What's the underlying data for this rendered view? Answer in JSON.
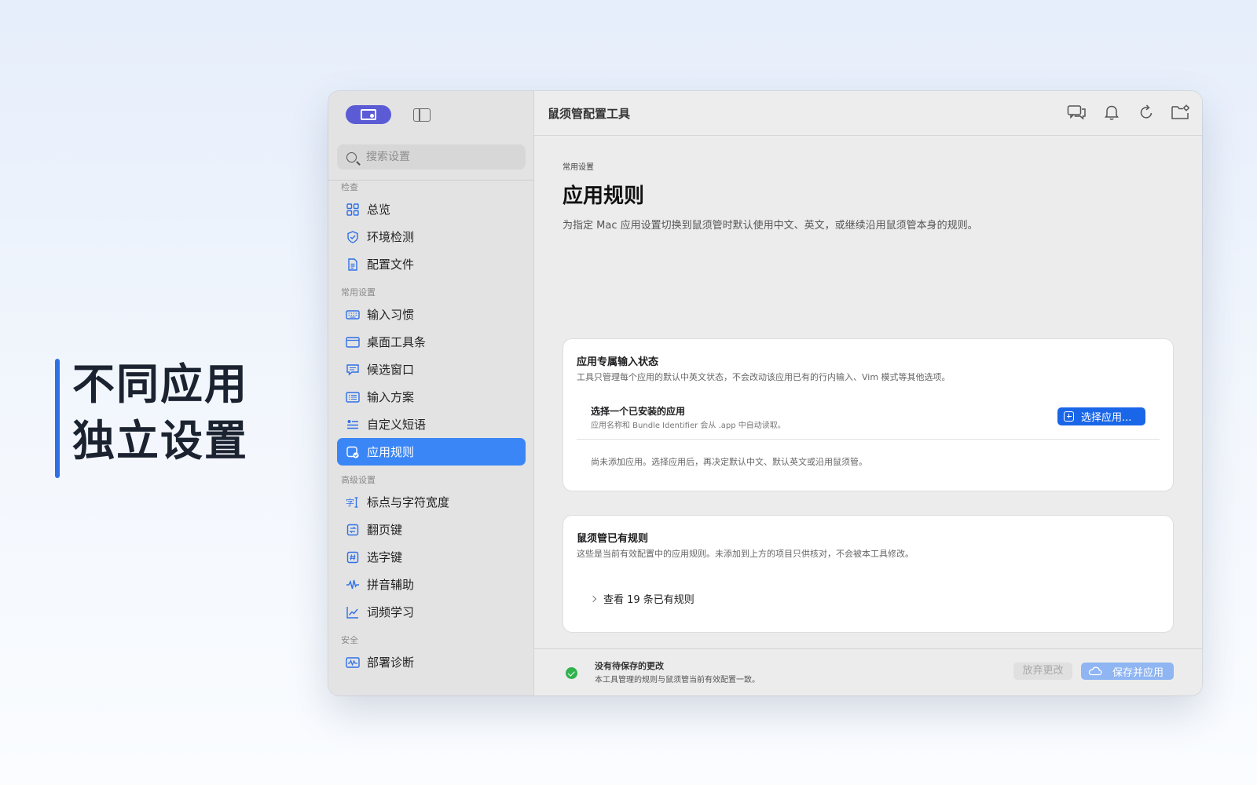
{
  "promo": {
    "line1": "不同应用",
    "line2": "独立设置"
  },
  "sidebar": {
    "search_placeholder": "搜索设置",
    "groups": [
      {
        "label": "检查",
        "items": [
          {
            "label": "总览",
            "icon": "grid-icon"
          },
          {
            "label": "环境检测",
            "icon": "shield-check-icon"
          },
          {
            "label": "配置文件",
            "icon": "document-icon"
          }
        ]
      },
      {
        "label": "常用设置",
        "items": [
          {
            "label": "输入习惯",
            "icon": "keyboard-icon"
          },
          {
            "label": "桌面工具条",
            "icon": "window-icon"
          },
          {
            "label": "候选窗口",
            "icon": "chat-bubble-icon"
          },
          {
            "label": "输入方案",
            "icon": "list-box-icon"
          },
          {
            "label": "自定义短语",
            "icon": "text-list-icon"
          },
          {
            "label": "应用规则",
            "icon": "app-check-icon",
            "active": true
          }
        ]
      },
      {
        "label": "高级设置",
        "items": [
          {
            "label": "标点与字符宽度",
            "icon": "char-width-icon"
          },
          {
            "label": "翻页键",
            "icon": "page-key-icon"
          },
          {
            "label": "选字键",
            "icon": "hash-key-icon"
          },
          {
            "label": "拼音辅助",
            "icon": "waveform-icon"
          },
          {
            "label": "词频学习",
            "icon": "chart-line-icon"
          }
        ]
      },
      {
        "label": "安全",
        "items": [
          {
            "label": "部署诊断",
            "icon": "monitor-wave-icon"
          }
        ]
      }
    ]
  },
  "header": {
    "title": "鼠须管配置工具"
  },
  "main": {
    "breadcrumb": "常用设置",
    "title": "应用规则",
    "description": "为指定 Mac 应用设置切换到鼠须管时默认使用中文、英文，或继续沿用鼠须管本身的规则。",
    "card1": {
      "title": "应用专属输入状态",
      "description": "工具只管理每个应用的默认中英文状态，不会改动该应用已有的行内输入、Vim 模式等其他选项。",
      "row_title": "选择一个已安装的应用",
      "row_desc": "应用名称和 Bundle Identifier 会从 .app 中自动读取。",
      "button": "选择应用...",
      "empty_note": "尚未添加应用。选择应用后，再决定默认中文、默认英文或沿用鼠须管。"
    },
    "card2": {
      "title": "鼠须管已有规则",
      "description": "这些是当前有效配置中的应用规则。未添加到上方的项目只供核对，不会被本工具修改。",
      "disclosure": "查看 19 条已有规则"
    }
  },
  "footer": {
    "status_title": "没有待保存的更改",
    "status_desc": "本工具管理的规则与鼠须管当前有效配置一致。",
    "discard_label": "放弃更改",
    "save_label": "保存并应用"
  },
  "colors": {
    "accent": "#3a86f6",
    "purple": "#5b5bd6",
    "success": "#30b24c",
    "promo_bar": "#2f6fe8"
  }
}
